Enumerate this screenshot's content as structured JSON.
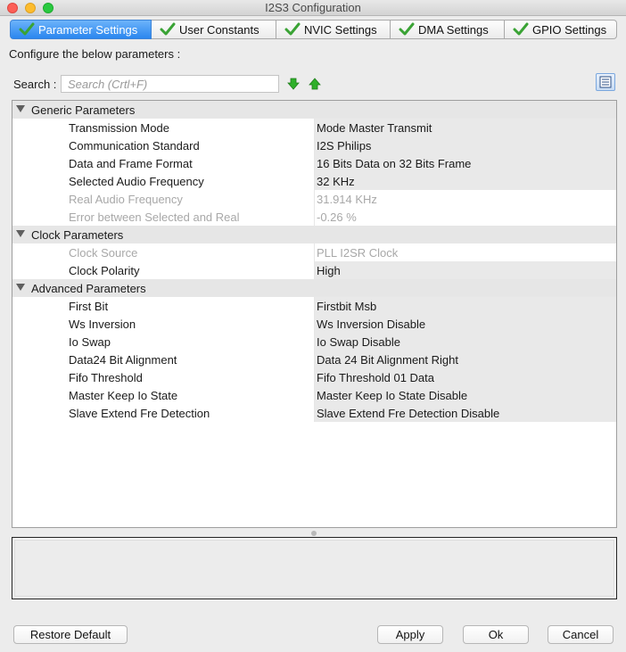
{
  "window": {
    "title": "I2S3 Configuration"
  },
  "tabs": [
    {
      "label": "Parameter Settings",
      "active": true
    },
    {
      "label": "User Constants",
      "active": false
    },
    {
      "label": "NVIC Settings",
      "active": false
    },
    {
      "label": "DMA Settings",
      "active": false
    },
    {
      "label": "GPIO Settings",
      "active": false
    }
  ],
  "main": {
    "configure_label": "Configure the below parameters :",
    "search_label": "Search :",
    "search_placeholder": "Search (Crtl+F)"
  },
  "groups": [
    {
      "label": "Generic Parameters",
      "params": [
        {
          "name": "Transmission Mode",
          "value": "Mode Master Transmit"
        },
        {
          "name": "Communication Standard",
          "value": "I2S Philips"
        },
        {
          "name": "Data and Frame Format",
          "value": "16 Bits Data on 32 Bits Frame"
        },
        {
          "name": "Selected Audio Frequency",
          "value": "32 KHz"
        },
        {
          "name": "Real Audio Frequency",
          "value": "31.914 KHz"
        },
        {
          "name": "Error between Selected and Real",
          "value": "-0.26 %"
        }
      ]
    },
    {
      "label": "Clock Parameters",
      "params": [
        {
          "name": "Clock Source",
          "value": "PLL I2SR Clock"
        },
        {
          "name": "Clock Polarity",
          "value": "High"
        }
      ]
    },
    {
      "label": "Advanced Parameters",
      "params": [
        {
          "name": "First Bit",
          "value": "Firstbit Msb"
        },
        {
          "name": "Ws Inversion",
          "value": "Ws Inversion Disable"
        },
        {
          "name": "Io Swap",
          "value": "Io Swap Disable"
        },
        {
          "name": "Data24 Bit Alignment",
          "value": "Data 24 Bit Alignment Right"
        },
        {
          "name": "Fifo Threshold",
          "value": "Fifo Threshold 01 Data"
        },
        {
          "name": "Master Keep Io State",
          "value": "Master Keep Io State Disable"
        },
        {
          "name": "Slave Extend Fre Detection",
          "value": "Slave Extend Fre Detection Disable"
        }
      ]
    }
  ],
  "buttons": {
    "restore_default": "Restore Default",
    "apply": "Apply",
    "ok": "Ok",
    "cancel": "Cancel"
  },
  "icons": {
    "tab_check": "check-icon",
    "arrow_down": "arrow-down-icon",
    "arrow_up": "arrow-up-icon",
    "view_toggle": "list-view-icon"
  },
  "colors": {
    "active_tab": "#2a86ef",
    "check_green": "#3aa335",
    "arrow_green": "#2fb02a"
  }
}
